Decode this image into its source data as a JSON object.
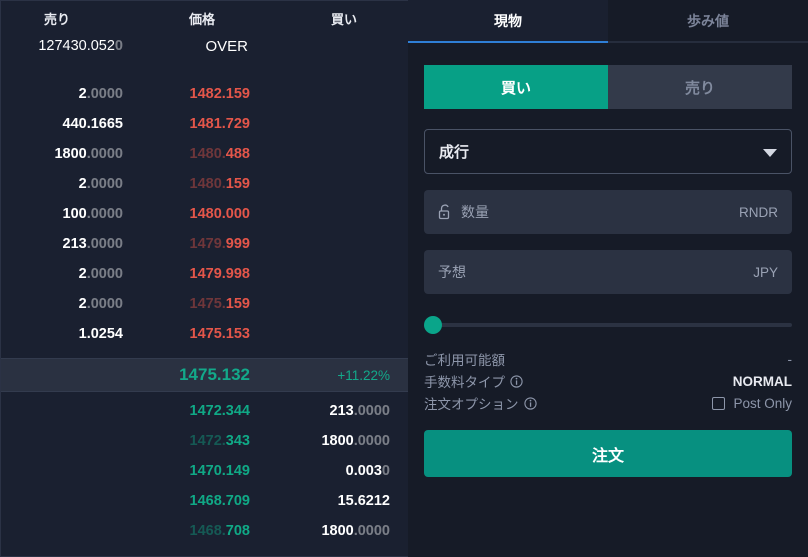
{
  "orderbook": {
    "headers": {
      "sell": "売り",
      "price": "価格",
      "buy": "買い"
    },
    "over": {
      "qty_main": "127430.052",
      "qty_dim": "0",
      "label": "OVER"
    },
    "asks": [
      {
        "qty_main": "2",
        "qty_dim": ".0000",
        "price_dim": "",
        "price_main": "1482.159"
      },
      {
        "qty_main": "440.1665",
        "qty_dim": "",
        "price_dim": "",
        "price_main": "1481.729"
      },
      {
        "qty_main": "1800",
        "qty_dim": ".0000",
        "price_dim": "1480.",
        "price_main": "488"
      },
      {
        "qty_main": "2",
        "qty_dim": ".0000",
        "price_dim": "1480.",
        "price_main": "159"
      },
      {
        "qty_main": "100",
        "qty_dim": ".0000",
        "price_dim": "",
        "price_main": "1480.000"
      },
      {
        "qty_main": "213",
        "qty_dim": ".0000",
        "price_dim": "1479.",
        "price_main": "999"
      },
      {
        "qty_main": "2",
        "qty_dim": ".0000",
        "price_dim": "",
        "price_main": "1479.998"
      },
      {
        "qty_main": "2",
        "qty_dim": ".0000",
        "price_dim": "1475.",
        "price_main": "159"
      },
      {
        "qty_main": "1.0254",
        "qty_dim": "",
        "price_dim": "",
        "price_main": "1475.153"
      }
    ],
    "mid": {
      "price": "1475.132",
      "change": "+11.22%"
    },
    "bids": [
      {
        "price_dim": "",
        "price_main": "1472.344",
        "qty_main": "213",
        "qty_dim": ".0000"
      },
      {
        "price_dim": "1472.",
        "price_main": "343",
        "qty_main": "1800",
        "qty_dim": ".0000"
      },
      {
        "price_dim": "",
        "price_main": "1470.149",
        "qty_main": "0.003",
        "qty_dim": "0"
      },
      {
        "price_dim": "",
        "price_main": "1468.709",
        "qty_main": "15.6212",
        "qty_dim": ""
      },
      {
        "price_dim": "1468.",
        "price_main": "708",
        "qty_main": "1800",
        "qty_dim": ".0000"
      }
    ]
  },
  "panel": {
    "tabs": [
      {
        "label": "現物",
        "active": true
      },
      {
        "label": "歩み値",
        "active": false
      }
    ],
    "side": {
      "buy_label": "買い",
      "sell_label": "売り"
    },
    "order_type": {
      "value": "成行"
    },
    "quantity": {
      "placeholder": "数量",
      "unit": "RNDR",
      "value": ""
    },
    "estimate": {
      "placeholder": "予想",
      "unit": "JPY",
      "value": ""
    },
    "slider": {
      "percent": 0
    },
    "info": {
      "available_label": "ご利用可能額",
      "available_value": "-",
      "fee_label": "手数料タイプ",
      "fee_value": "NORMAL",
      "option_label": "注文オプション",
      "post_only_label": "Post Only"
    },
    "submit_label": "注文"
  },
  "colors": {
    "ask": "#e4564a",
    "bid": "#10a986",
    "accent_teal": "#07a086",
    "tab_underline": "#2f7fd6",
    "panel_bg": "#161b27",
    "book_bg": "#1a2030"
  }
}
